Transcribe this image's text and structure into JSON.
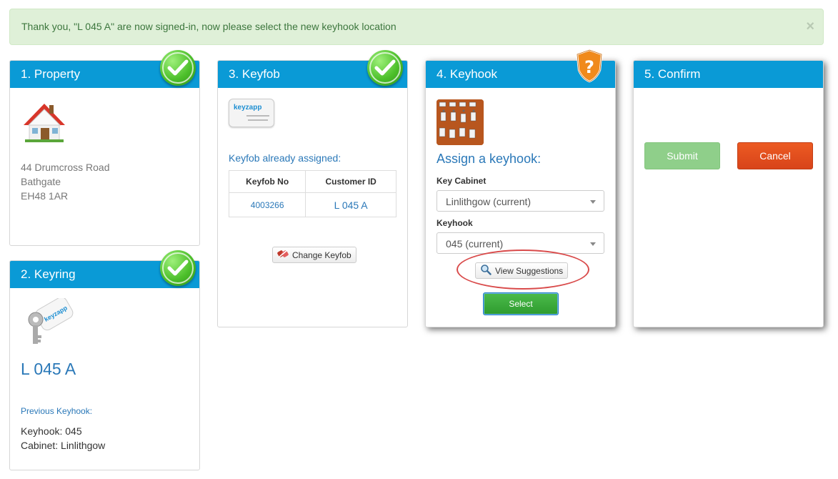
{
  "alert": {
    "message": "Thank you, \"L 045 A\" are now signed-in, now please select the new keyhook location",
    "close_glyph": "×"
  },
  "property": {
    "title": "1. Property",
    "address": [
      "44 Drumcross Road",
      "Bathgate",
      "EH48 1AR"
    ]
  },
  "keyring": {
    "title": "2. Keyring",
    "code": "L 045 A",
    "previous_label": "Previous Keyhook:",
    "keyhook_line": "Keyhook: 045",
    "cabinet_line": "Cabinet: Linlithgow"
  },
  "keyfob": {
    "title": "3. Keyfob",
    "fob_brand": "keyzapp",
    "assigned_text": "Keyfob already assigned:",
    "table_headers": [
      "Keyfob No",
      "Customer ID"
    ],
    "table_row": [
      "4003266",
      "L 045 A"
    ],
    "change_button": "Change Keyfob"
  },
  "keyhook": {
    "title": "4. Keyhook",
    "heading": "Assign a keyhook:",
    "cabinet_label": "Key Cabinet",
    "cabinet_value": "Linlithgow (current)",
    "hook_label": "Keyhook",
    "hook_value": "045 (current)",
    "suggest_button": "View Suggestions",
    "select_button": "Select"
  },
  "confirm": {
    "title": "5. Confirm",
    "submit_button": "Submit",
    "cancel_button": "Cancel"
  },
  "colors": {
    "header_blue": "#0a9ad6",
    "success_green": "#5cb85c",
    "danger_orange": "#e8501f",
    "alert_bg": "#dff0d8",
    "warning_orange": "#f08a1c"
  },
  "icons": {
    "step_complete": "check-circle-icon",
    "step_pending": "question-shield-icon",
    "property": "house-icon",
    "keyring": "key-tag-icon",
    "keyfob": "keyfob-card-icon",
    "change": "unlink-icon",
    "suggest": "magnifier-icon"
  }
}
